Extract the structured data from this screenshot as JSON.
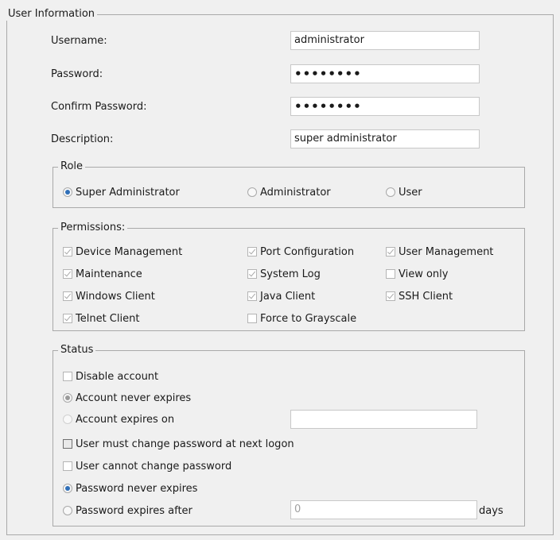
{
  "user_info": {
    "legend": "User Information",
    "username_label": "Username:",
    "username_value": "administrator",
    "password_label": "Password:",
    "password_value": "••••••••",
    "confirm_password_label": "Confirm Password:",
    "confirm_password_value": "••••••••",
    "description_label": "Description:",
    "description_value": "super administrator"
  },
  "role": {
    "legend": "Role",
    "options": [
      "Super Administrator",
      "Administrator",
      "User"
    ],
    "selected": "Super Administrator"
  },
  "permissions": {
    "legend": "Permissions:",
    "items": [
      {
        "label": "Device Management",
        "checked": true
      },
      {
        "label": "Port Configuration",
        "checked": true
      },
      {
        "label": "User Management",
        "checked": true
      },
      {
        "label": "Maintenance",
        "checked": true
      },
      {
        "label": "System Log",
        "checked": true
      },
      {
        "label": "View only",
        "checked": false
      },
      {
        "label": "Windows Client",
        "checked": true
      },
      {
        "label": "Java Client",
        "checked": true
      },
      {
        "label": "SSH Client",
        "checked": true
      },
      {
        "label": "Telnet Client",
        "checked": true
      },
      {
        "label": "Force to Grayscale",
        "checked": false
      }
    ]
  },
  "status": {
    "legend": "Status",
    "disable_account": "Disable account",
    "account_never_expires": "Account never expires",
    "account_expires_on": "Account expires on",
    "account_expires_on_value": "",
    "must_change_password": "User must change password at next logon",
    "cannot_change_password": "User cannot change password",
    "password_never_expires": "Password never expires",
    "password_expires_after": "Password expires after",
    "password_expires_days_value": "0",
    "days_unit": "days"
  }
}
